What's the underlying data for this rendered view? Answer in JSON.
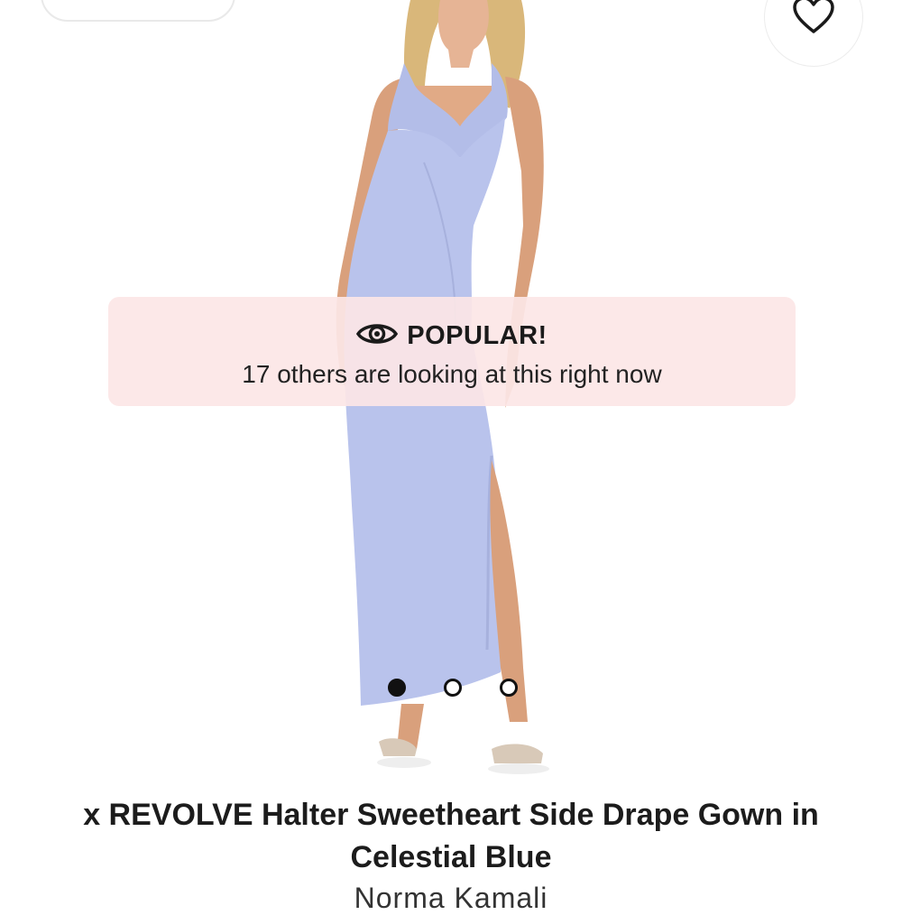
{
  "favorite_button": {
    "icon": "heart-icon"
  },
  "gallery": {
    "image_description": "product-photo-model-in-light-blue-halter-gown",
    "dress_color": "#b9c3ec",
    "slide_count": 3,
    "active_slide": 1
  },
  "popular_banner": {
    "icon": "eye-icon",
    "title": "POPULAR!",
    "message": "17 others are looking at this right now",
    "background": "#fce6e6"
  },
  "product": {
    "title": "x REVOLVE Halter Sweetheart Side Drape Gown in Celestial Blue",
    "brand": "Norma Kamali"
  }
}
